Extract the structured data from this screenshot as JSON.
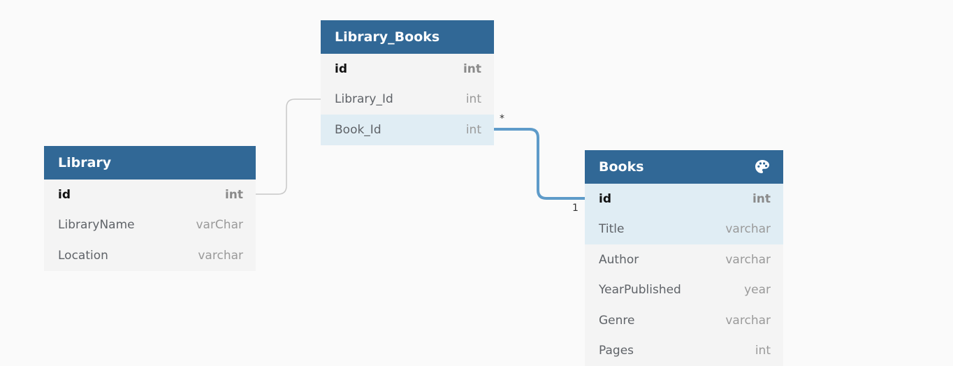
{
  "tables": {
    "library_books": {
      "title": "Library_Books",
      "columns": [
        {
          "name": "id",
          "type": "int"
        },
        {
          "name": "Library_Id",
          "type": "int"
        },
        {
          "name": "Book_Id",
          "type": "int"
        }
      ]
    },
    "library": {
      "title": "Library",
      "columns": [
        {
          "name": "id",
          "type": "int"
        },
        {
          "name": "LibraryName",
          "type": "varChar"
        },
        {
          "name": "Location",
          "type": "varchar"
        }
      ]
    },
    "books": {
      "title": "Books",
      "header_icon": "palette-icon",
      "columns": [
        {
          "name": "id",
          "type": "int"
        },
        {
          "name": "Title",
          "type": "varchar"
        },
        {
          "name": "Author",
          "type": "varchar"
        },
        {
          "name": "YearPublished",
          "type": "year"
        },
        {
          "name": "Genre",
          "type": "varchar"
        },
        {
          "name": "Pages",
          "type": "int"
        }
      ]
    }
  },
  "relationships": [
    {
      "from": "Library.id",
      "to": "Library_Books.Library_Id",
      "style": "thin-gray"
    },
    {
      "from": "Library_Books.Book_Id",
      "to": "Books.id",
      "style": "highlighted-blue",
      "from_cardinality": "*",
      "to_cardinality": "1"
    }
  ],
  "colors": {
    "header": "#316896",
    "row": "#f4f4f4",
    "row_highlight": "#e0edf4",
    "relation_highlight": "#5e9bc9",
    "relation_plain": "#c8c8c8",
    "background": "#fafafa"
  }
}
